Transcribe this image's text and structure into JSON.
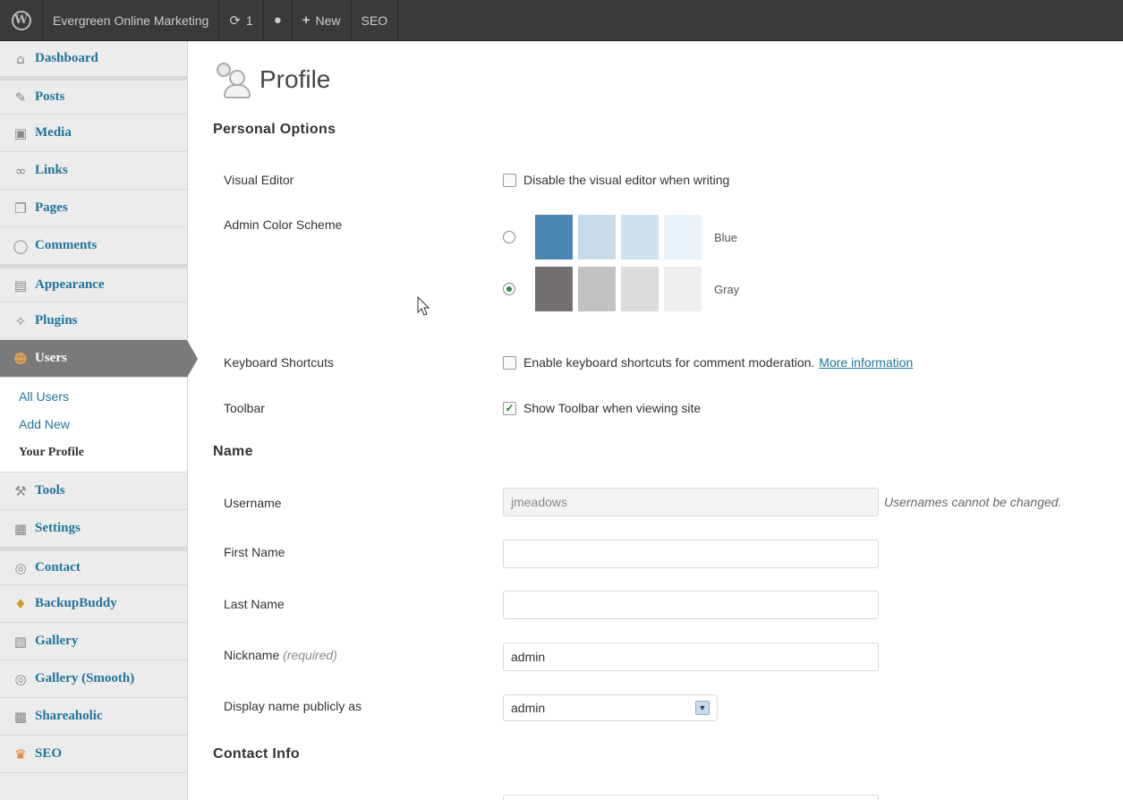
{
  "toolbar": {
    "site_name": "Evergreen Online Marketing",
    "updates_count": "1",
    "new_label": "New",
    "seo_label": "SEO"
  },
  "sidebar": {
    "items": [
      {
        "label": "Dashboard",
        "icon": "home-icon"
      },
      {
        "label": "Posts",
        "icon": "pin-icon"
      },
      {
        "label": "Media",
        "icon": "media-icon"
      },
      {
        "label": "Links",
        "icon": "link-icon"
      },
      {
        "label": "Pages",
        "icon": "pages-icon"
      },
      {
        "label": "Comments",
        "icon": "comment-icon"
      },
      {
        "label": "Appearance",
        "icon": "appearance-icon"
      },
      {
        "label": "Plugins",
        "icon": "plugin-icon"
      },
      {
        "label": "Users",
        "icon": "users-icon"
      },
      {
        "label": "Tools",
        "icon": "tools-icon"
      },
      {
        "label": "Settings",
        "icon": "settings-icon"
      },
      {
        "label": "Contact",
        "icon": "contact-icon"
      },
      {
        "label": "BackupBuddy",
        "icon": "backupbuddy-icon"
      },
      {
        "label": "Gallery",
        "icon": "gallery-icon"
      },
      {
        "label": "Gallery (Smooth)",
        "icon": "gallery-smooth-icon"
      },
      {
        "label": "Shareaholic",
        "icon": "shareaholic-icon"
      },
      {
        "label": "SEO",
        "icon": "seo-icon"
      }
    ],
    "users_submenu": [
      "All Users",
      "Add New",
      "Your Profile"
    ]
  },
  "page": {
    "title": "Profile",
    "personal_options": "Personal Options",
    "visual_editor_label": "Visual Editor",
    "visual_editor_text": "Disable the visual editor when writing",
    "color_scheme_label": "Admin Color Scheme",
    "schemes": [
      {
        "name": "Blue",
        "selected": false,
        "colors": [
          "#4a86b0",
          "#c9dbe9",
          "#cfe1ee",
          "#e9f3fa"
        ]
      },
      {
        "name": "Gray",
        "selected": true,
        "colors": [
          "#747070",
          "#c2c2c2",
          "#dcdcdc",
          "#efefef"
        ]
      }
    ],
    "keyboard_label": "Keyboard Shortcuts",
    "keyboard_text": "Enable keyboard shortcuts for comment moderation.",
    "keyboard_link": "More information",
    "toolbar_label": "Toolbar",
    "toolbar_text": "Show Toolbar when viewing site",
    "name_heading": "Name",
    "username_label": "Username",
    "username_value": "jmeadows",
    "username_hint": "Usernames cannot be changed.",
    "first_name_label": "First Name",
    "first_name_value": "",
    "last_name_label": "Last Name",
    "last_name_value": "",
    "nickname_label": "Nickname",
    "nickname_required": "(required)",
    "nickname_value": "admin",
    "display_name_label": "Display name publicly as",
    "display_name_value": "admin",
    "contact_heading": "Contact Info"
  }
}
